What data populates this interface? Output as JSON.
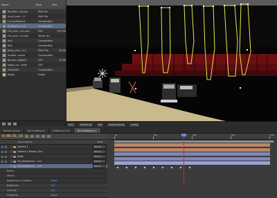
{
  "project_panel": {
    "headers": {
      "name": "Name",
      "type": "Type",
      "size": "Size"
    },
    "items": [
      {
        "name": "Rauditor...bourne",
        "type": "PNG File",
        "size": "",
        "kind": "file"
      },
      {
        "name": "Audit_Audi...r0",
        "type": "PNG File",
        "size": "",
        "kind": "file"
      },
      {
        "name": "Full Auditorium",
        "type": "Composition",
        "size": "",
        "kind": "comp"
      },
      {
        "name": "Auditorium_full",
        "type": "Composition",
        "size": "",
        "kind": "comp",
        "selected": true
      },
      {
        "name": "Full_aud...-c1c.psd",
        "type": "PSD",
        "size": "612 KB",
        "kind": "file"
      },
      {
        "name": "Full_aud...c1c.psd",
        "type": "Vector Art",
        "size": "",
        "kind": "file"
      },
      {
        "name": "Null",
        "type": "Composition",
        "size": "",
        "kind": "comp"
      },
      {
        "name": "Red",
        "type": "Composition",
        "size": "",
        "kind": "comp"
      },
      {
        "name": "Seats_aud...c1c",
        "type": "Pixel File",
        "size": "98 KB",
        "kind": "file"
      },
      {
        "name": "Auditor...scene",
        "type": "Composition",
        "size": "",
        "kind": "comp"
      },
      {
        "name": "Render_Lighted",
        "type": "TIFF",
        "size": "24 KB",
        "kind": "file"
      },
      {
        "name": "stage_ras...bnd0",
        "type": "TIFF",
        "size": "",
        "kind": "file"
      },
      {
        "name": "SeatSolid",
        "type": "Composition",
        "size": "",
        "kind": "comp"
      },
      {
        "name": "Solids",
        "type": "Folder",
        "size": "",
        "kind": "folder"
      }
    ]
  },
  "viewer": {
    "toolbar": {
      "zoom": "50%",
      "timecode": "0;00;01;16",
      "resolution": "Full",
      "camera": "Active Camera",
      "view": "1 View"
    }
  },
  "timeline": {
    "tabs": [
      "Render Queue",
      "Full Auditorium",
      "Auditorium_full",
      "Full Auditorium 2"
    ],
    "active_tab": 3,
    "timecode": "0;00;01;16",
    "ruler_labels": [
      "0s",
      "01s",
      "02s",
      "03s",
      "04s"
    ],
    "column_header": "Source Name",
    "mode_header": "Mode",
    "layers": [
      {
        "num": "1",
        "name": "Camera 1",
        "mode": "Normal",
        "color": "#c98a57",
        "selected": false
      },
      {
        "num": "2",
        "name": "Camera 2 Design 2/Ins",
        "mode": "Normal",
        "color": "#c98a57",
        "selected": false
      },
      {
        "num": "3",
        "name": "Seats",
        "mode": "Normal",
        "color": "#7d8fb8",
        "selected": false
      },
      {
        "num": "4",
        "name": "Full_Auditorium-...3.ai",
        "mode": "Normal",
        "color": "#7d8fb8",
        "selected": false
      },
      {
        "num": "5",
        "name": "Full_Auditorium-...3.ai",
        "mode": "Normal",
        "color": "#7d8fb8",
        "selected": true
      }
    ],
    "properties": [
      {
        "name": "Masks",
        "value": ""
      },
      {
        "name": "Effects",
        "value": ""
      },
      {
        "name": "Brightness & Contrast",
        "value": "Reset"
      },
      {
        "name": "Brightness",
        "value": "0.0"
      },
      {
        "name": "Contrast",
        "value": "0.0"
      },
      {
        "name": "Transform",
        "value": "Reset"
      }
    ]
  },
  "colors": {
    "accent": "#ffd34a",
    "cti": "#e02424",
    "selection": "#596a86",
    "mask_path": "#e8e84a"
  }
}
